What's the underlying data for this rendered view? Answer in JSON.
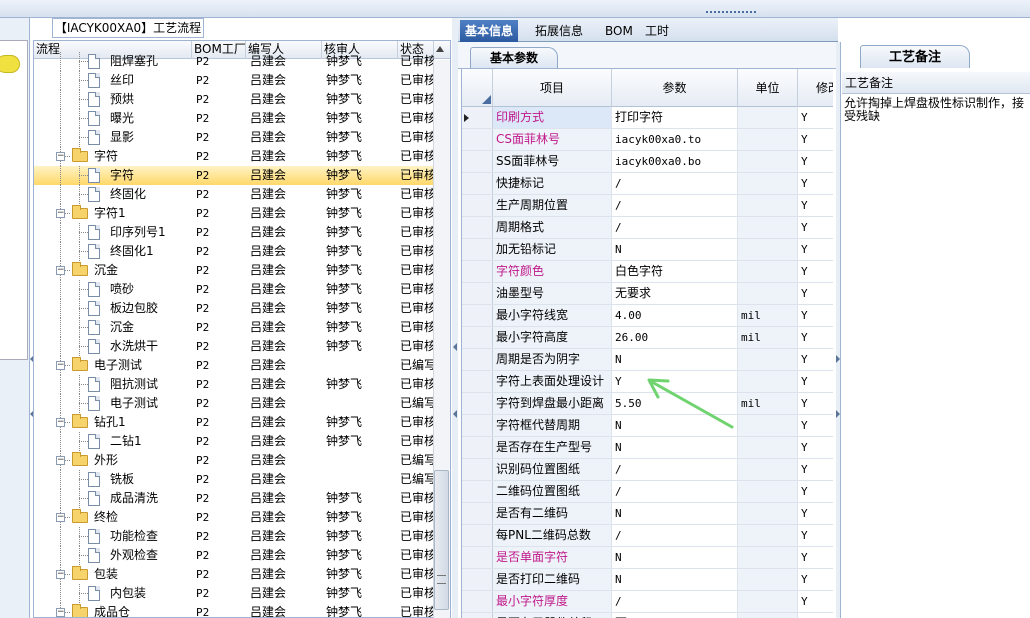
{
  "tree_panel": {
    "title": "【IACYK00XA0】工艺流程",
    "columns": [
      "流程",
      "BOM工厂",
      "编写人",
      "核审人",
      "状态"
    ],
    "rows": [
      {
        "label": "阻焊塞孔",
        "bom": "P2",
        "writer": "吕建会",
        "reviewer": "钟梦飞",
        "status": "已审核",
        "type": "doc",
        "level": 2
      },
      {
        "label": "丝印",
        "bom": "P2",
        "writer": "吕建会",
        "reviewer": "钟梦飞",
        "status": "已审核",
        "type": "doc",
        "level": 2
      },
      {
        "label": "预烘",
        "bom": "P2",
        "writer": "吕建会",
        "reviewer": "钟梦飞",
        "status": "已审核",
        "type": "doc",
        "level": 2
      },
      {
        "label": "曝光",
        "bom": "P2",
        "writer": "吕建会",
        "reviewer": "钟梦飞",
        "status": "已审核",
        "type": "doc",
        "level": 2
      },
      {
        "label": "显影",
        "bom": "P2",
        "writer": "吕建会",
        "reviewer": "钟梦飞",
        "status": "已审核",
        "type": "doc",
        "level": 2
      },
      {
        "label": "字符",
        "bom": "P2",
        "writer": "吕建会",
        "reviewer": "钟梦飞",
        "status": "已审核",
        "type": "folder",
        "level": 1
      },
      {
        "label": "字符",
        "bom": "P2",
        "writer": "吕建会",
        "reviewer": "钟梦飞",
        "status": "已审核",
        "type": "doc",
        "level": 2,
        "selected": true
      },
      {
        "label": "终固化",
        "bom": "P2",
        "writer": "吕建会",
        "reviewer": "钟梦飞",
        "status": "已审核",
        "type": "doc",
        "level": 2
      },
      {
        "label": "字符1",
        "bom": "P2",
        "writer": "吕建会",
        "reviewer": "钟梦飞",
        "status": "已审核",
        "type": "folder",
        "level": 1
      },
      {
        "label": "印序列号1",
        "bom": "P2",
        "writer": "吕建会",
        "reviewer": "钟梦飞",
        "status": "已审核",
        "type": "doc",
        "level": 2
      },
      {
        "label": "终固化1",
        "bom": "P2",
        "writer": "吕建会",
        "reviewer": "钟梦飞",
        "status": "已审核",
        "type": "doc",
        "level": 2
      },
      {
        "label": "沉金",
        "bom": "P2",
        "writer": "吕建会",
        "reviewer": "钟梦飞",
        "status": "已审核",
        "type": "folder",
        "level": 1
      },
      {
        "label": "喷砂",
        "bom": "P2",
        "writer": "吕建会",
        "reviewer": "钟梦飞",
        "status": "已审核",
        "type": "doc",
        "level": 2
      },
      {
        "label": "板边包胶",
        "bom": "P2",
        "writer": "吕建会",
        "reviewer": "钟梦飞",
        "status": "已审核",
        "type": "doc",
        "level": 2
      },
      {
        "label": "沉金",
        "bom": "P2",
        "writer": "吕建会",
        "reviewer": "钟梦飞",
        "status": "已审核",
        "type": "doc",
        "level": 2
      },
      {
        "label": "水洗烘干",
        "bom": "P2",
        "writer": "吕建会",
        "reviewer": "钟梦飞",
        "status": "已审核",
        "type": "doc",
        "level": 2
      },
      {
        "label": "电子测试",
        "bom": "P2",
        "writer": "吕建会",
        "reviewer": "",
        "status": "已编写",
        "type": "folder",
        "level": 1
      },
      {
        "label": "阻抗测试",
        "bom": "P2",
        "writer": "吕建会",
        "reviewer": "钟梦飞",
        "status": "已审核",
        "type": "doc",
        "level": 2
      },
      {
        "label": "电子测试",
        "bom": "P2",
        "writer": "吕建会",
        "reviewer": "",
        "status": "已编写",
        "type": "doc",
        "level": 2
      },
      {
        "label": "钻孔1",
        "bom": "P2",
        "writer": "吕建会",
        "reviewer": "钟梦飞",
        "status": "已审核",
        "type": "folder",
        "level": 1
      },
      {
        "label": "二钻1",
        "bom": "P2",
        "writer": "吕建会",
        "reviewer": "钟梦飞",
        "status": "已审核",
        "type": "doc",
        "level": 2
      },
      {
        "label": "外形",
        "bom": "P2",
        "writer": "吕建会",
        "reviewer": "",
        "status": "已编写",
        "type": "folder",
        "level": 1
      },
      {
        "label": "铣板",
        "bom": "P2",
        "writer": "吕建会",
        "reviewer": "",
        "status": "已编写",
        "type": "doc",
        "level": 2
      },
      {
        "label": "成品清洗",
        "bom": "P2",
        "writer": "吕建会",
        "reviewer": "钟梦飞",
        "status": "已审核",
        "type": "doc",
        "level": 2
      },
      {
        "label": "终检",
        "bom": "P2",
        "writer": "吕建会",
        "reviewer": "钟梦飞",
        "status": "已审核",
        "type": "folder",
        "level": 1
      },
      {
        "label": "功能检查",
        "bom": "P2",
        "writer": "吕建会",
        "reviewer": "钟梦飞",
        "status": "已审核",
        "type": "doc",
        "level": 2
      },
      {
        "label": "外观检查",
        "bom": "P2",
        "writer": "吕建会",
        "reviewer": "钟梦飞",
        "status": "已审核",
        "type": "doc",
        "level": 2
      },
      {
        "label": "包装",
        "bom": "P2",
        "writer": "吕建会",
        "reviewer": "钟梦飞",
        "status": "已审核",
        "type": "folder",
        "level": 1
      },
      {
        "label": "内包装",
        "bom": "P2",
        "writer": "吕建会",
        "reviewer": "钟梦飞",
        "status": "已审核",
        "type": "doc",
        "level": 2
      },
      {
        "label": "成品仓",
        "bom": "P2",
        "writer": "吕建会",
        "reviewer": "钟梦飞",
        "status": "已审核",
        "type": "folder",
        "level": 1
      }
    ]
  },
  "main_tabs": [
    "基本信息",
    "拓展信息",
    "BOM",
    "工时"
  ],
  "sub_tab": "基本参数",
  "grid": {
    "columns": [
      "项目",
      "参数",
      "单位",
      "修改"
    ],
    "rows": [
      {
        "name": "印刷方式",
        "value": "打印字符",
        "unit": "",
        "mod": "Y",
        "pink": true,
        "current": true
      },
      {
        "name": "CS面菲林号",
        "value": "iacyk00xa0.to",
        "unit": "",
        "mod": "Y",
        "pink": true
      },
      {
        "name": "SS面菲林号",
        "value": "iacyk00xa0.bo",
        "unit": "",
        "mod": "Y"
      },
      {
        "name": "快捷标记",
        "value": "/",
        "unit": "",
        "mod": "Y"
      },
      {
        "name": "生产周期位置",
        "value": "/",
        "unit": "",
        "mod": "Y"
      },
      {
        "name": "周期格式",
        "value": "/",
        "unit": "",
        "mod": "Y"
      },
      {
        "name": "加无铅标记",
        "value": "N",
        "unit": "",
        "mod": "Y"
      },
      {
        "name": "字符颜色",
        "value": "白色字符",
        "unit": "",
        "mod": "Y",
        "pink": true
      },
      {
        "name": "油墨型号",
        "value": "无要求",
        "unit": "",
        "mod": "Y"
      },
      {
        "name": "最小字符线宽",
        "value": "4.00",
        "unit": "mil",
        "mod": "Y"
      },
      {
        "name": "最小字符高度",
        "value": "26.00",
        "unit": "mil",
        "mod": "Y"
      },
      {
        "name": "周期是否为阴字",
        "value": "N",
        "unit": "",
        "mod": "Y"
      },
      {
        "name": "字符上表面处理设计",
        "value": "Y",
        "unit": "",
        "mod": "Y"
      },
      {
        "name": "字符到焊盘最小距离",
        "value": "5.50",
        "unit": "mil",
        "mod": "Y"
      },
      {
        "name": "字符框代替周期",
        "value": "N",
        "unit": "",
        "mod": "Y"
      },
      {
        "name": "是否存在生产型号",
        "value": "N",
        "unit": "",
        "mod": "Y"
      },
      {
        "name": "识别码位置图纸",
        "value": "/",
        "unit": "",
        "mod": "Y"
      },
      {
        "name": "二维码位置图纸",
        "value": "/",
        "unit": "",
        "mod": "Y"
      },
      {
        "name": "是否有二维码",
        "value": "N",
        "unit": "",
        "mod": "Y"
      },
      {
        "name": "每PNL二维码总数",
        "value": "/",
        "unit": "",
        "mod": "Y"
      },
      {
        "name": "是否单面字符",
        "value": "N",
        "unit": "",
        "mod": "Y",
        "pink": true
      },
      {
        "name": "是否打印二维码",
        "value": "N",
        "unit": "",
        "mod": "Y"
      },
      {
        "name": "最小字符厚度",
        "value": "/",
        "unit": "",
        "mod": "Y",
        "pink": true
      },
      {
        "name": "是否有元器件丝印",
        "value": "否",
        "unit": "",
        "mod": "Y"
      }
    ]
  },
  "remarks": {
    "tab": "工艺备注",
    "header": "工艺备注",
    "text": "允许掏掉上焊盘极性标识制作，接受残缺"
  },
  "colors": {
    "pink": "#c0188a",
    "accent": "#2c5aa0",
    "arrow": "#6fd36f"
  }
}
